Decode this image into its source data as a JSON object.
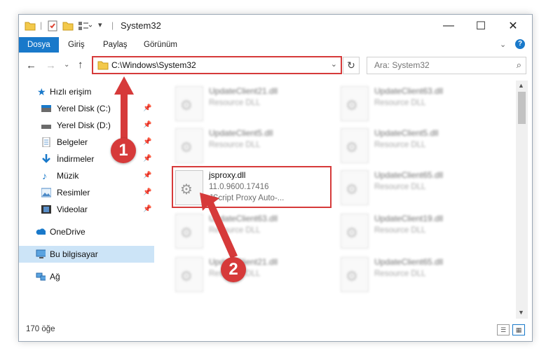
{
  "window": {
    "title": "System32",
    "controls": {
      "minimize": "—",
      "maximize": "☐",
      "close": "✕"
    }
  },
  "ribbon": {
    "tabs": [
      {
        "label": "Dosya",
        "active": true
      },
      {
        "label": "Giriş"
      },
      {
        "label": "Paylaş"
      },
      {
        "label": "Görünüm"
      }
    ]
  },
  "nav": {
    "address": "C:\\Windows\\System32",
    "search_placeholder": "Ara: System32"
  },
  "sidebar": {
    "items": [
      {
        "label": "Hızlı erişim",
        "icon": "star-icon"
      },
      {
        "label": "Yerel Disk (C:)",
        "icon": "drive-icon",
        "pinned": true
      },
      {
        "label": "Yerel Disk (D:)",
        "icon": "drive-icon",
        "pinned": true
      },
      {
        "label": "Belgeler",
        "icon": "documents-icon",
        "pinned": true
      },
      {
        "label": "İndirmeler",
        "icon": "download-icon",
        "pinned": true
      },
      {
        "label": "Müzik",
        "icon": "music-icon",
        "pinned": true
      },
      {
        "label": "Resimler",
        "icon": "pictures-icon",
        "pinned": true
      },
      {
        "label": "Videolar",
        "icon": "videos-icon",
        "pinned": true
      },
      {
        "label": "OneDrive",
        "icon": "cloud-icon"
      },
      {
        "label": "Bu bilgisayar",
        "icon": "computer-icon",
        "selected": true
      },
      {
        "label": "Ağ",
        "icon": "network-icon"
      }
    ]
  },
  "files": [
    {
      "name": "UpdateClient21.dll",
      "line2": "Resource DLL",
      "line3": ""
    },
    {
      "name": "UpdateClient63.dll",
      "line2": "Resource DLL",
      "line3": ""
    },
    {
      "name": "UpdateClient5.dll",
      "line2": "Resource DLL",
      "line3": ""
    },
    {
      "name": "UpdateClient5.dll",
      "line2": "Resource DLL",
      "line3": ""
    },
    {
      "name": "jsproxy.dll",
      "line2": "11.0.9600.17416",
      "line3": "JScript Proxy Auto-..."
    },
    {
      "name": "UpdateClient65.dll",
      "line2": "Resource DLL",
      "line3": ""
    },
    {
      "name": "UpdateClient63.dll",
      "line2": "Resource DLL",
      "line3": ""
    },
    {
      "name": "UpdateClient19.dll",
      "line2": "Resource DLL",
      "line3": ""
    },
    {
      "name": "UpdateClient21.dll",
      "line2": "Resource DLL",
      "line3": ""
    },
    {
      "name": "UpdateClient65.dll",
      "line2": "Resource DLL",
      "line3": ""
    }
  ],
  "status": {
    "count": "170 öğe"
  },
  "annotations": {
    "badge1": "1",
    "badge2": "2",
    "color": "#d63a3a"
  }
}
